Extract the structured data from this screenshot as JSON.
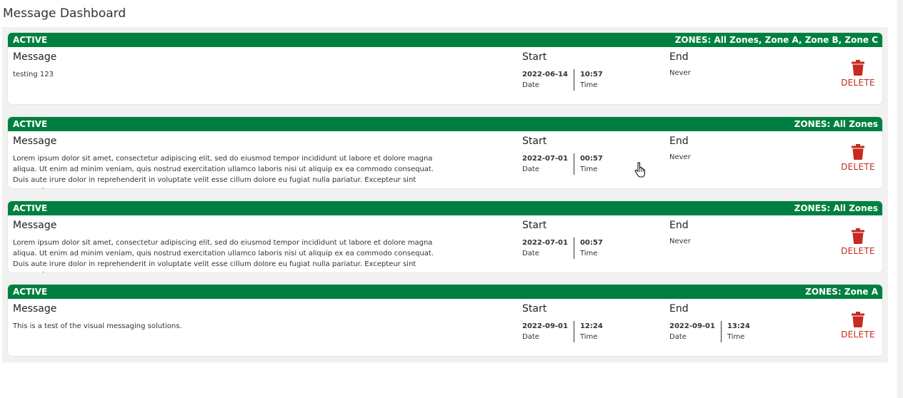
{
  "page": {
    "title": "Message Dashboard"
  },
  "labels": {
    "message": "Message",
    "start": "Start",
    "end": "End",
    "date": "Date",
    "time": "Time",
    "delete": "DELETE"
  },
  "colors": {
    "header": "#008040",
    "delete": "#c62a20"
  },
  "icons": {
    "delete": "trash-icon",
    "cursor": "hand-pointer-icon"
  },
  "messages": [
    {
      "status": "ACTIVE",
      "zones": "ZONES: All Zones, Zone A, Zone B, Zone C",
      "text": "testing 123",
      "start_date": "2022-06-14",
      "start_time": "10:57",
      "end_text": "Never"
    },
    {
      "status": "ACTIVE",
      "zones": "ZONES: All Zones",
      "text": "Lorem ipsum dolor sit amet, consectetur adipiscing elit, sed do eiusmod tempor incididunt ut labore et dolore magna aliqua. Ut enim ad minim veniam, quis nostrud exercitation ullamco laboris nisi ut aliquip ex ea commodo consequat. Duis aute irure dolor in reprehenderit in voluptate velit esse cillum dolore eu fugiat nulla pariatur. Excepteur sint occaecat...",
      "start_date": "2022-07-01",
      "start_time": "00:57",
      "end_text": "Never"
    },
    {
      "status": "ACTIVE",
      "zones": "ZONES: All Zones",
      "text": "Lorem ipsum dolor sit amet, consectetur adipiscing elit, sed do eiusmod tempor incididunt ut labore et dolore magna aliqua. Ut enim ad minim veniam, quis nostrud exercitation ullamco laboris nisi ut aliquip ex ea commodo consequat. Duis aute irure dolor in reprehenderit in voluptate velit esse cillum dolore eu fugiat nulla pariatur. Excepteur sint occaecat...",
      "start_date": "2022-07-01",
      "start_time": "00:57",
      "end_text": "Never"
    },
    {
      "status": "ACTIVE",
      "zones": "ZONES: Zone A",
      "text": "This is a test of the visual messaging solutions.",
      "start_date": "2022-09-01",
      "start_time": "12:24",
      "end_date": "2022-09-01",
      "end_time": "13:24"
    }
  ]
}
